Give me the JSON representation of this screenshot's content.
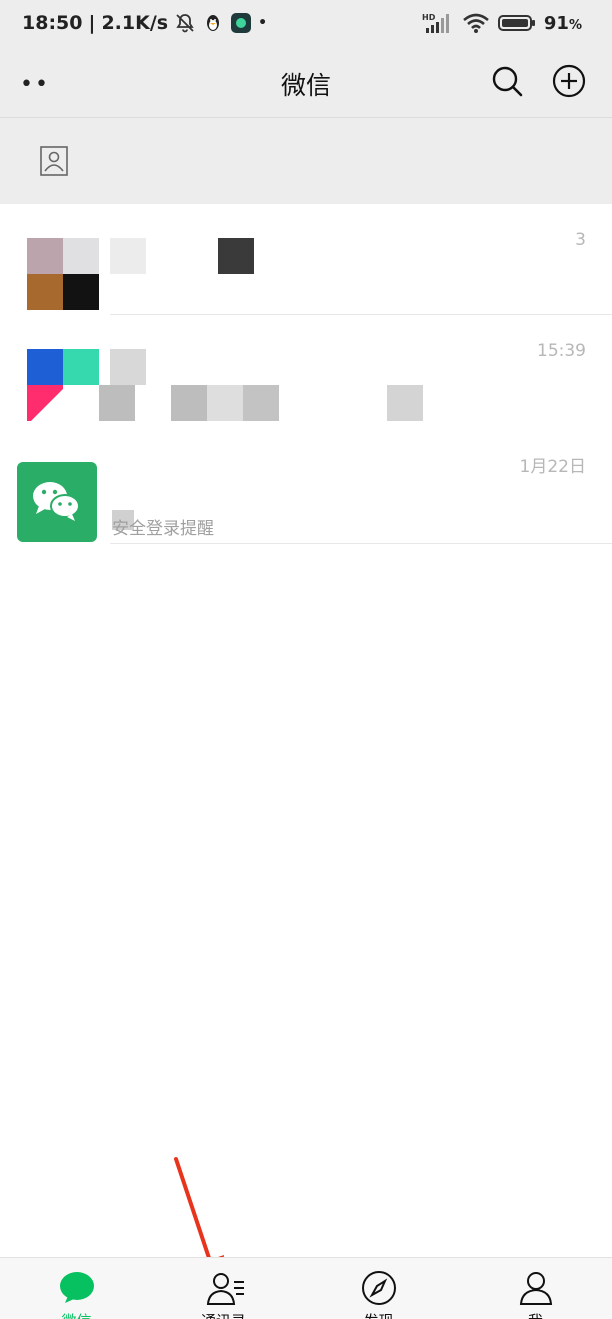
{
  "status_bar": {
    "time": "18:50",
    "speed": "2.1K/s",
    "battery": "91",
    "battery_unit": "%",
    "hd_label": "HD"
  },
  "header": {
    "title": "微信",
    "more_icon": "more-dots-icon",
    "search_icon": "search-icon",
    "add_icon": "add-circle-icon"
  },
  "top_strip": {
    "icon": "contact-card-icon"
  },
  "chats": [
    {
      "time": "3",
      "preview": ""
    },
    {
      "time": "15:39",
      "preview": ""
    },
    {
      "time": "1月22日",
      "preview": "安全登录提醒"
    }
  ],
  "tabs": [
    {
      "label": "微信",
      "icon": "chat-bubble-icon",
      "active": true
    },
    {
      "label": "通讯录",
      "icon": "contacts-icon",
      "active": false
    },
    {
      "label": "发现",
      "icon": "compass-icon",
      "active": false
    },
    {
      "label": "我",
      "icon": "person-icon",
      "active": false
    }
  ],
  "colors": {
    "accent": "#07c160",
    "arrow": "#e8341c",
    "header_bg": "#ededed"
  }
}
